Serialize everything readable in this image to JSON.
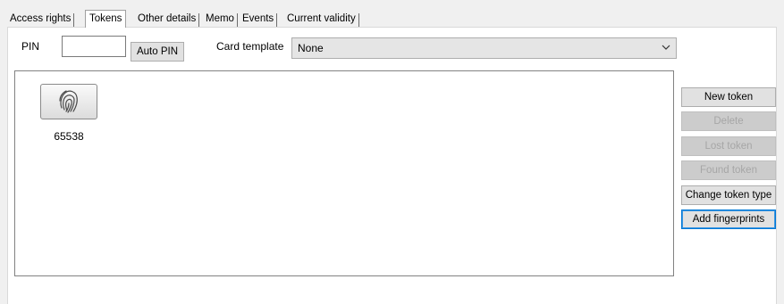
{
  "tabs": [
    {
      "label": "Access rights",
      "active": false
    },
    {
      "label": "Tokens",
      "active": true
    },
    {
      "label": "Other details",
      "active": false
    },
    {
      "label": "Memo",
      "active": false
    },
    {
      "label": "Events",
      "active": false
    },
    {
      "label": "Current validity",
      "active": false
    }
  ],
  "pin": {
    "label": "PIN",
    "value": "",
    "auto_label": "Auto PIN"
  },
  "card_template": {
    "label": "Card template",
    "value": "None",
    "dropdown_icon": "chevron-down-icon"
  },
  "tokens": [
    {
      "label": "65538",
      "icon": "fingerprint-icon"
    }
  ],
  "actions": {
    "new_token": "New token",
    "delete": "Delete",
    "lost_token": "Lost token",
    "found_token": "Found token",
    "change_token_type": "Change token type",
    "add_fingerprints": "Add fingerprints"
  }
}
